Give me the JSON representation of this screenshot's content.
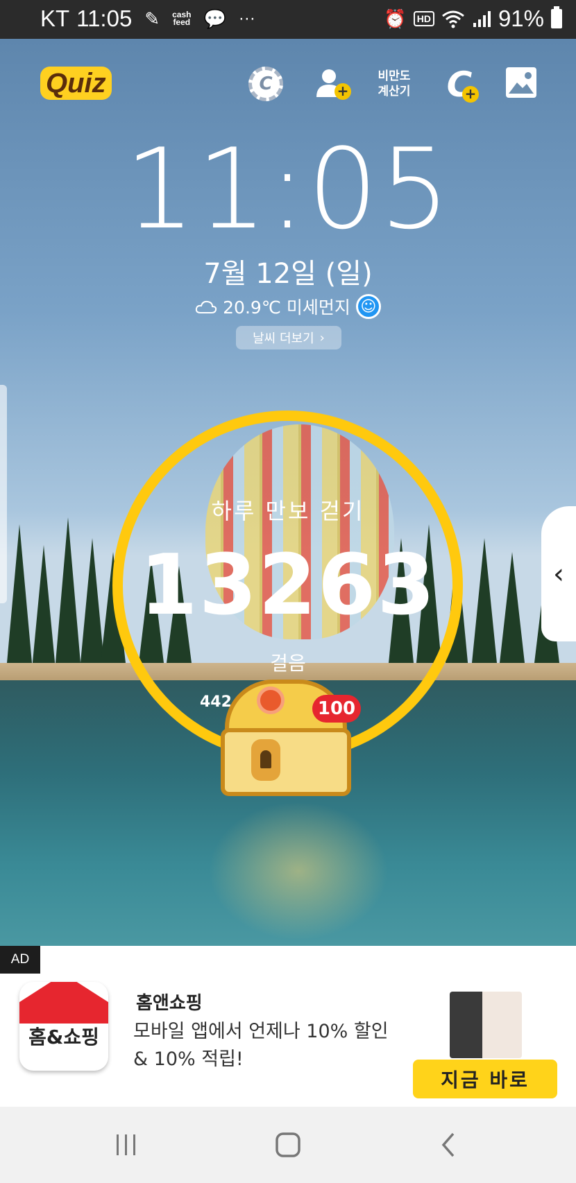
{
  "status_bar": {
    "carrier": "KT",
    "time": "11:05",
    "cashfeed_line1": "cash",
    "cashfeed_line2": "feed",
    "more": "···",
    "hd": "HD",
    "battery": "91%"
  },
  "toolbar": {
    "quiz_label": "Quiz",
    "coin_label": "C",
    "bmi_line1": "비만도",
    "bmi_line2": "계산기",
    "add_coin_label": "C",
    "plus": "+"
  },
  "clock": {
    "time": "11:05",
    "date": "7월 12일 (일)",
    "weather": "20.9℃ 미세먼지",
    "more_weather": "날씨 더보기"
  },
  "steps": {
    "title": "하루 만보 걷기",
    "count": "13263",
    "unit": "걸음",
    "partial_number": "442",
    "reward_badge": "100"
  },
  "ad": {
    "tag": "AD",
    "logo_text": "홈&쇼핑",
    "title": "홈앤쇼핑",
    "desc_line1": "모바일 앱에서 언제나 10% 할인",
    "desc_line2": "& 10% 적립!",
    "cta": "지금 바로"
  },
  "colors": {
    "ring": "#ffc90e",
    "badge": "#e6262f",
    "cta": "#ffd31a"
  }
}
